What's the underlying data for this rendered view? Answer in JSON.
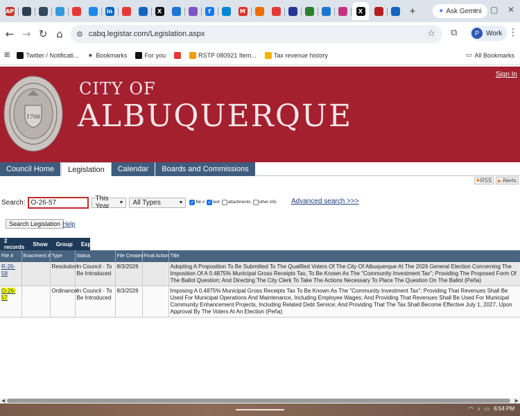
{
  "browser": {
    "tabs": [
      {
        "icon": "ap-news-icon",
        "label": "AP",
        "color": "#c0392b"
      },
      {
        "icon": "circle-icon",
        "label": "",
        "color": "#2c3e50"
      },
      {
        "icon": "tab-icon",
        "label": "",
        "color": "#34495e"
      },
      {
        "icon": "tab-icon",
        "label": "",
        "color": "#3498db"
      },
      {
        "icon": "youtube-icon",
        "label": "",
        "color": "#e53935"
      },
      {
        "icon": "tab-icon",
        "label": "",
        "color": "#1e88e5"
      },
      {
        "icon": "linkedin-icon",
        "label": "in",
        "color": "#0a66c2"
      },
      {
        "icon": "tab-icon",
        "label": "",
        "color": "#e53935"
      },
      {
        "icon": "tab-icon",
        "label": "",
        "color": "#1565c0"
      },
      {
        "icon": "x-icon",
        "label": "X",
        "color": "#111111"
      },
      {
        "icon": "tab-icon",
        "label": "",
        "color": "#1976d2"
      },
      {
        "icon": "tab-icon",
        "label": "",
        "color": "#7e57c2"
      },
      {
        "icon": "facebook-icon",
        "label": "f",
        "color": "#1877f2"
      },
      {
        "icon": "tab-icon",
        "label": "",
        "color": "#0288d1"
      },
      {
        "icon": "gmail-icon",
        "label": "M",
        "color": "#d93025"
      },
      {
        "icon": "tab-icon",
        "label": "",
        "color": "#ef6c00"
      },
      {
        "icon": "youtube-icon",
        "label": "",
        "color": "#e53935"
      },
      {
        "icon": "tab-icon",
        "label": "",
        "color": "#283593"
      },
      {
        "icon": "tab-icon",
        "label": "",
        "color": "#2e7d32"
      },
      {
        "icon": "tab-icon",
        "label": "",
        "color": "#1976d2"
      },
      {
        "icon": "instagram-icon",
        "label": "",
        "color": "#c13584"
      },
      {
        "icon": "x-icon",
        "label": "X",
        "color": "#111111",
        "active": true
      },
      {
        "icon": "tab-icon",
        "label": "",
        "color": "#b71c1c"
      },
      {
        "icon": "tab-icon",
        "label": "",
        "color": "#1565c0"
      }
    ],
    "ask_gemini": "Ask Gemini",
    "url": "cabq.legistar.com/Legislation.aspx",
    "profile_initial": "P",
    "profile_label": "Work",
    "bookmarks": [
      {
        "icon": "x-icon",
        "label": "Twitter / Notificati...",
        "color": "#111111"
      },
      {
        "icon": "star-icon",
        "label": "Bookmarks",
        "color": ""
      },
      {
        "icon": "x-icon",
        "label": "For you",
        "color": "#111111"
      },
      {
        "icon": "youtube-icon",
        "label": "",
        "color": "#e53935"
      },
      {
        "icon": "rstp-icon",
        "label": "RSTP 080921 Item...",
        "color": "#f39c12"
      },
      {
        "icon": "chart-icon",
        "label": "Tax revenue history",
        "color": "#f4b400"
      }
    ],
    "all_bookmarks": "All Bookmarks"
  },
  "header": {
    "city_of": "CITY OF",
    "city_name": "ALBUQUERQUE",
    "sign_in": "Sign In",
    "seal_year": "1706",
    "brand_color": "#a4202f"
  },
  "nav": {
    "tabs": [
      "Council Home",
      "Legislation",
      "Calendar",
      "Boards and Commissions"
    ],
    "active": "Legislation"
  },
  "feeds": {
    "rss": "RSS",
    "alerts": "Alerts"
  },
  "search": {
    "label": "Search:",
    "value": "O-26-57",
    "year": "This Year",
    "type": "All Types",
    "options": [
      {
        "label": "file #",
        "checked": true
      },
      {
        "label": "text",
        "checked": true
      },
      {
        "label": "attachments",
        "checked": false
      },
      {
        "label": "other info",
        "checked": false
      }
    ],
    "advanced": "Advanced search >>>",
    "button": "Search Legislation",
    "help": "Help"
  },
  "grid": {
    "toolbar": {
      "records": "2 records",
      "show": "Show",
      "group": "Group",
      "export": "Export"
    },
    "columns": [
      "File #",
      "Enactment #",
      "Type",
      "Status",
      "File Created",
      "Final Action",
      "Title"
    ],
    "rows": [
      {
        "file": "R-26-58",
        "enactment": "",
        "type": "Resolution",
        "status": "In Council - To Be Introduced",
        "created": "8/3/2026",
        "final": "",
        "title": "Adopting A Proposition To Be Submitted To The Qualified Voters Of The City Of Albuquerque At The 2026 General Election Concerning The Imposition Of A 0.4875% Municipal Gross Receipts Tax, To Be Known As The \"Community Investment Tax\"; Providing The Proposed Form Of The Ballot Question; And Directing The City Clerk To Take The Actions Necessary To Place The Question On The Ballot (Peña)"
      },
      {
        "file": "O-26-57",
        "enactment": "",
        "type": "Ordinance",
        "status": "In Council - To Be Introduced",
        "created": "8/3/2026",
        "final": "",
        "title": "Imposing A 0.4875% Municipal Gross Receipts Tax To Be Known As The \"Community Investment Tax\"; Providing That Revenues Shall Be Used For Municipal Operations And Maintenance, Including Employee Wages; And Providing That Revenues Shall Be Used For Municipal Community Enhancement Projects, Including Related Debt Service; And Providing That The Tax Shall Become Effective July 1, 2027, Upon Approval By The Voters At An Election (Peña)"
      }
    ]
  },
  "taskbar": {
    "time": "6:54 PM"
  }
}
